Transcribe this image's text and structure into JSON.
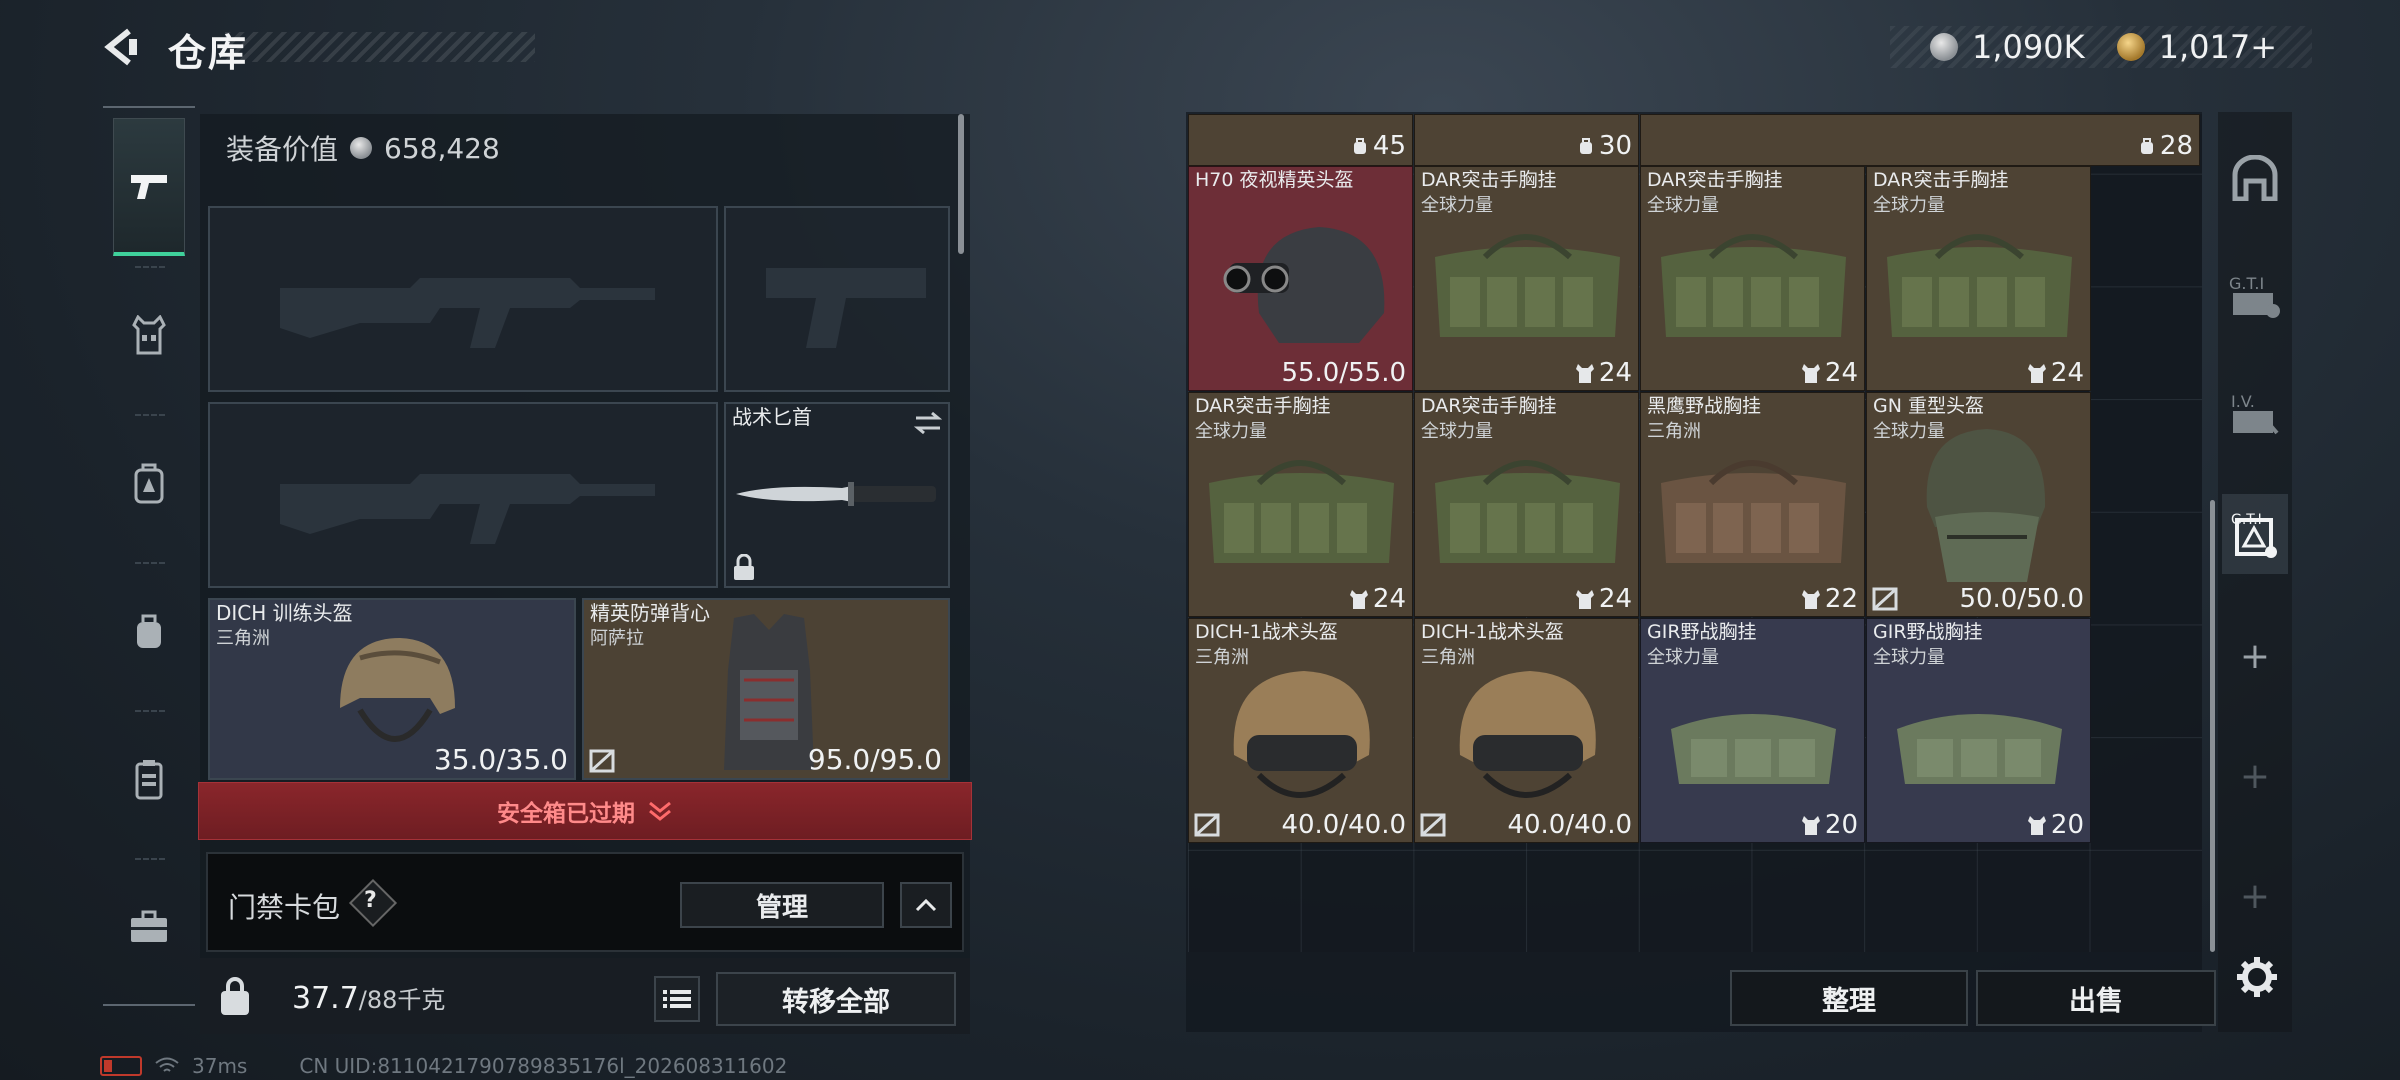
{
  "header": {
    "title": "仓库",
    "currency": [
      {
        "icon": "silver-coin-icon",
        "value": "1,090K"
      },
      {
        "icon": "gold-coin-icon",
        "value": "1,017+"
      }
    ]
  },
  "left_tabs": [
    "weapon-tab-icon",
    "vest-tab-icon",
    "backpack-tab-icon",
    "pouch-tab-icon",
    "case-tab-icon",
    "briefcase-tab-icon"
  ],
  "equipment": {
    "value_label": "装备价值",
    "value": "658,428",
    "slots": {
      "knife": {
        "name": "战术匕首"
      },
      "helmet": {
        "name": "DICH 训练头盔",
        "sub": "三角洲",
        "durability": "35.0/35.0"
      },
      "armor": {
        "name": "精英防弹背心",
        "sub": "阿萨拉",
        "durability": "95.0/95.0"
      }
    },
    "secure_case_status": "安全箱已过期",
    "card_pack": {
      "label": "门禁卡包",
      "help": "?",
      "manage": "管理"
    },
    "weight_current": "37.7",
    "weight_max": "/88千克",
    "transfer_all": "转移全部"
  },
  "status_bar": {
    "ping": "37ms",
    "uid": "CN UID:8110421790789835176l_202608311602"
  },
  "inventory": {
    "top_partial_caps": [
      "45",
      "30",
      "28"
    ],
    "items": [
      {
        "name": "H70 夜视精英头盔",
        "sub": "",
        "value": "55.0/55.0",
        "type": "durability",
        "color": "red"
      },
      {
        "name": "DAR突击手胸挂",
        "sub": "全球力量",
        "value": "24",
        "type": "capacity",
        "color": "brown"
      },
      {
        "name": "DAR突击手胸挂",
        "sub": "全球力量",
        "value": "24",
        "type": "capacity",
        "color": "brown"
      },
      {
        "name": "DAR突击手胸挂",
        "sub": "全球力量",
        "value": "24",
        "type": "capacity",
        "color": "brown"
      },
      {
        "name": "DAR突击手胸挂",
        "sub": "全球力量",
        "value": "24",
        "type": "capacity",
        "color": "brown"
      },
      {
        "name": "DAR突击手胸挂",
        "sub": "全球力量",
        "value": "24",
        "type": "capacity",
        "color": "brown"
      },
      {
        "name": "黑鹰野战胸挂",
        "sub": "三角洲",
        "value": "22",
        "type": "capacity",
        "color": "brown"
      },
      {
        "name": "GN 重型头盔",
        "sub": "全球力量",
        "value": "50.0/50.0",
        "type": "durability",
        "color": "brown"
      },
      {
        "name": "DICH-1战术头盔",
        "sub": "三角洲",
        "value": "40.0/40.0",
        "type": "durability",
        "color": "brown"
      },
      {
        "name": "DICH-1战术头盔",
        "sub": "三角洲",
        "value": "40.0/40.0",
        "type": "durability",
        "color": "brown"
      },
      {
        "name": "GIR野战胸挂",
        "sub": "全球力量",
        "value": "20",
        "type": "capacity",
        "color": "blue"
      },
      {
        "name": "GIR野战胸挂",
        "sub": "全球力量",
        "value": "20",
        "type": "capacity",
        "color": "blue"
      }
    ],
    "sort": "整理",
    "sell": "出售"
  },
  "colors": {
    "accent_green": "#3fd19b",
    "expired_red": "#8a262b",
    "item_brown": "#4e4334",
    "item_red": "#6d2e37",
    "item_blue": "#373a4e"
  }
}
